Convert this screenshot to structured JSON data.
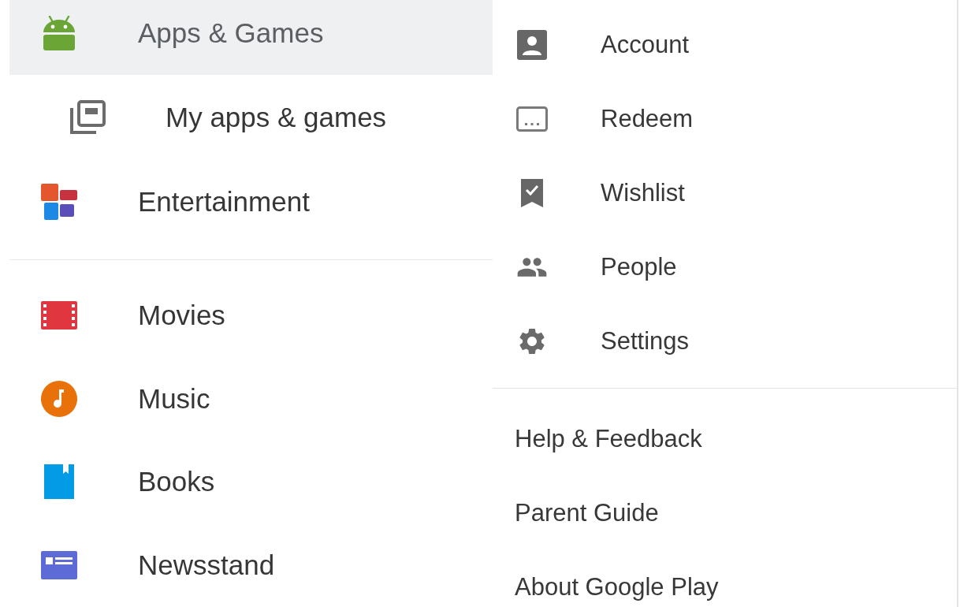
{
  "left_nav": [
    {
      "items": [
        {
          "label": "Apps & Games",
          "selected": true,
          "children": [
            {
              "label": "My apps & games",
              "selected": false
            }
          ]
        },
        {
          "label": "Entertainment",
          "selected": false
        }
      ]
    },
    {
      "items": [
        {
          "label": "Movies",
          "selected": false
        },
        {
          "label": "Music",
          "selected": false
        },
        {
          "label": "Books",
          "selected": false
        },
        {
          "label": "Newsstand",
          "selected": false
        }
      ]
    }
  ],
  "account_menu": [
    {
      "label": "Account"
    },
    {
      "label": "Redeem"
    },
    {
      "label": "Wishlist"
    },
    {
      "label": "People"
    },
    {
      "label": "Settings"
    }
  ],
  "footer_links": [
    {
      "label": "Help & Feedback"
    },
    {
      "label": "Parent Guide"
    },
    {
      "label": "About Google Play"
    }
  ]
}
